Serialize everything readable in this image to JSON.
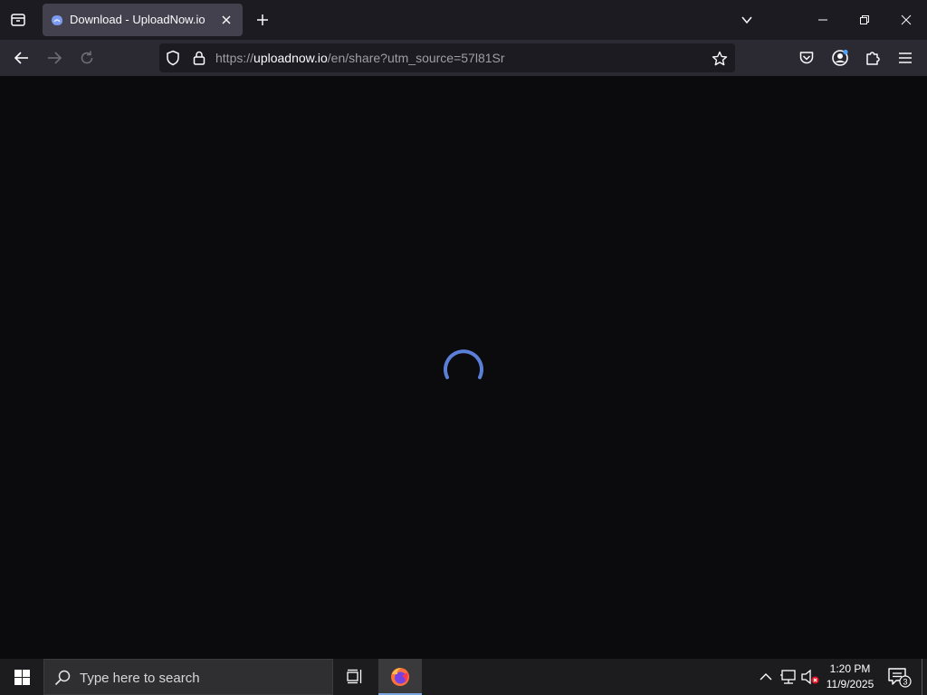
{
  "browser": {
    "tab": {
      "title": "Download - UploadNow.io",
      "favicon": "uploadnow-favicon"
    },
    "url": {
      "prefix": "https://",
      "domain": "uploadnow.io",
      "path": "/en/share?utm_source=57l81Sr"
    },
    "icons": {
      "tab_list": "tab-list-icon",
      "tab_close": "close-icon",
      "new_tab": "plus-icon",
      "list_all_tabs": "chevron-down-icon",
      "minimize": "minimize-icon",
      "maximize": "restore-icon",
      "window_close": "close-icon",
      "back": "arrow-left-icon",
      "forward": "arrow-right-icon",
      "reload": "reload-icon",
      "tracking": "shield-icon",
      "lock": "lock-icon",
      "bookmark": "star-icon",
      "pocket": "pocket-icon",
      "account": "account-icon",
      "extensions": "puzzle-icon",
      "menu": "hamburger-icon"
    },
    "colors": {
      "accent": "#5b7fd8",
      "tab_active": "#42414d",
      "toolbar": "#2b2a33",
      "tabstrip": "#1c1b22",
      "content": "#0b0b0d"
    }
  },
  "content": {
    "state": "loading",
    "spinner": "loading-spinner-icon"
  },
  "taskbar": {
    "search_placeholder": "Type here to search",
    "time": "1:20 PM",
    "date": "11/9/2025",
    "notifications_count": "3",
    "apps": [
      "Task View",
      "Firefox"
    ]
  }
}
